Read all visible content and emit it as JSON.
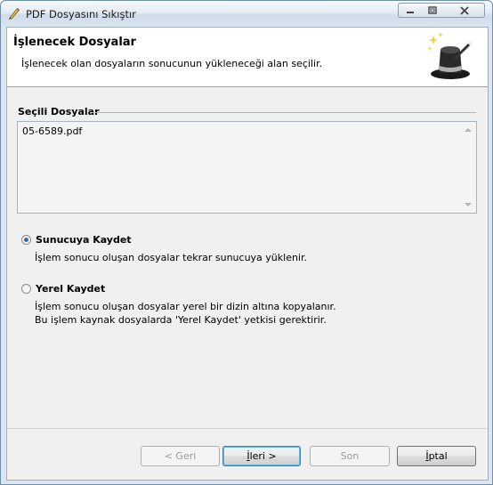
{
  "window": {
    "title": "PDF Dosyasını Sıkıştır"
  },
  "header": {
    "title": "İşlenecek Dosyalar",
    "subtitle": "İşlenecek olan dosyaların sonucunun yükleneceği alan seçilir."
  },
  "files_group": {
    "label": "Seçili Dosyalar",
    "items": [
      "05-6589.pdf"
    ]
  },
  "options": [
    {
      "label": "Sunucuya Kaydet",
      "checked": true,
      "description": [
        "İşlem sonucu oluşan dosyalar tekrar sunucuya yüklenir."
      ]
    },
    {
      "label": "Yerel Kaydet",
      "checked": false,
      "description": [
        "İşlem sonucu oluşan dosyalar yerel bir dizin altına kopyalanır.",
        "Bu işlem kaynak dosyalarda 'Yerel Kaydet' yetkisi gerektirir."
      ]
    }
  ],
  "buttons": {
    "back": "< Geri",
    "next_underlined": "İ",
    "next_rest": "leri >",
    "finish": "Son",
    "cancel_underlined": "İ",
    "cancel_rest": "ptal"
  }
}
